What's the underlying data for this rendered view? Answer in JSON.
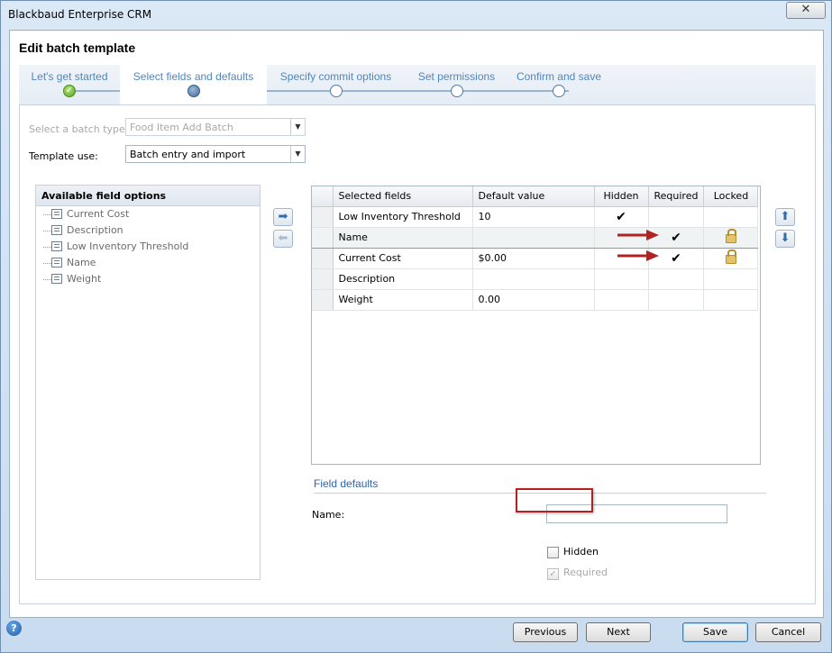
{
  "window": {
    "title": "Blackbaud Enterprise CRM",
    "close_glyph": "✕"
  },
  "dialog": {
    "title": "Edit batch template"
  },
  "wizard": {
    "steps": [
      {
        "label": "Let's get started",
        "state": "done"
      },
      {
        "label": "Select fields and defaults",
        "state": "current"
      },
      {
        "label": "Specify commit options",
        "state": "pending"
      },
      {
        "label": "Set permissions",
        "state": "pending"
      },
      {
        "label": "Confirm and save",
        "state": "pending"
      }
    ]
  },
  "form": {
    "batch_type_label": "Select a batch type:",
    "batch_type_value": "Food Item Add Batch",
    "template_use_label": "Template use:",
    "template_use_value": "Batch entry and import"
  },
  "available": {
    "header": "Available field options",
    "items": [
      "Current Cost",
      "Description",
      "Low Inventory Threshold",
      "Name",
      "Weight"
    ]
  },
  "grid": {
    "columns": [
      "Selected fields",
      "Default value",
      "Hidden",
      "Required",
      "Locked"
    ],
    "rows": [
      {
        "field": "Low Inventory Threshold",
        "default": "10",
        "hidden": "✔",
        "required": "",
        "locked": false
      },
      {
        "field": "Name",
        "default": "",
        "hidden": "",
        "required": "✔",
        "locked": true
      },
      {
        "field": "Current Cost",
        "default": "$0.00",
        "hidden": "",
        "required": "✔",
        "locked": true
      },
      {
        "field": "Description",
        "default": "",
        "hidden": "",
        "required": "",
        "locked": false
      },
      {
        "field": "Weight",
        "default": "0.00",
        "hidden": "",
        "required": "",
        "locked": false
      }
    ]
  },
  "field_defaults": {
    "title": "Field defaults",
    "name_label": "Name:",
    "name_value": "",
    "hidden_label": "Hidden",
    "required_label": "Required",
    "required_checked": "✓"
  },
  "buttons": {
    "previous": "Previous",
    "next": "Next",
    "save": "Save",
    "cancel": "Cancel",
    "help": "?"
  },
  "icons": {
    "move_right": "➡",
    "move_left": "⬅",
    "move_up": "⬆",
    "move_down": "⬇",
    "step_done": "✓"
  },
  "colors": {
    "accent": "#4f86bd",
    "annotation": "#b22222"
  }
}
